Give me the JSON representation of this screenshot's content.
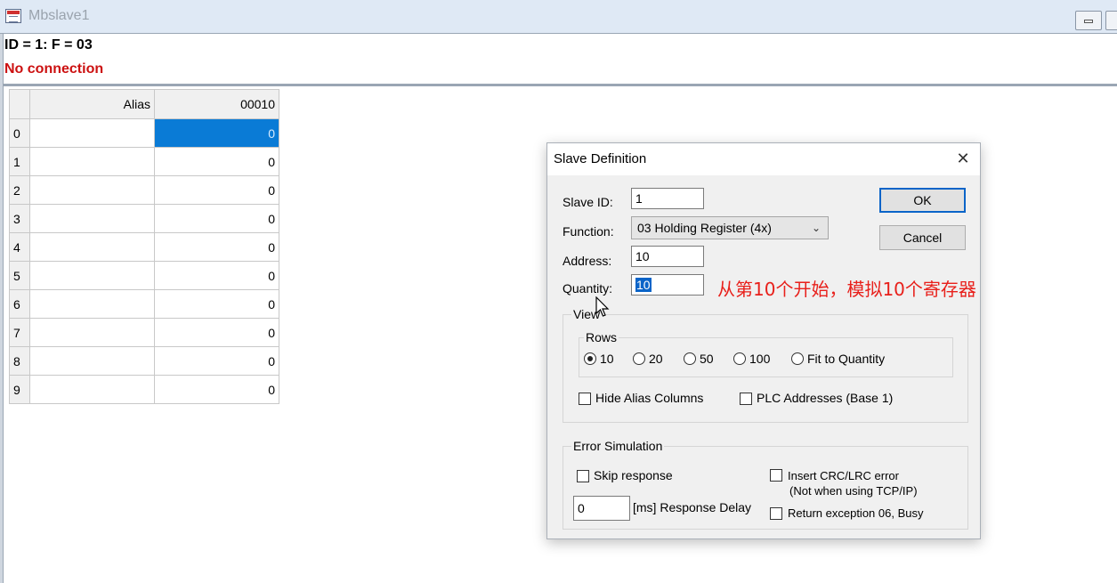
{
  "window": {
    "title": "Mbslave1"
  },
  "status": {
    "id_line": "ID = 1: F = 03",
    "connection": "No connection"
  },
  "grid": {
    "columns": [
      "Alias",
      "00010"
    ],
    "rows": [
      {
        "index": "0",
        "alias": "",
        "value": "0"
      },
      {
        "index": "1",
        "alias": "",
        "value": "0"
      },
      {
        "index": "2",
        "alias": "",
        "value": "0"
      },
      {
        "index": "3",
        "alias": "",
        "value": "0"
      },
      {
        "index": "4",
        "alias": "",
        "value": "0"
      },
      {
        "index": "5",
        "alias": "",
        "value": "0"
      },
      {
        "index": "6",
        "alias": "",
        "value": "0"
      },
      {
        "index": "7",
        "alias": "",
        "value": "0"
      },
      {
        "index": "8",
        "alias": "",
        "value": "0"
      },
      {
        "index": "9",
        "alias": "",
        "value": "0"
      }
    ],
    "selected_row": 0
  },
  "dialog": {
    "title": "Slave Definition",
    "close_glyph": "✕",
    "slave_id": {
      "label": "Slave ID:",
      "value": "1"
    },
    "function": {
      "label": "Function:",
      "value": "03 Holding Register (4x)"
    },
    "address": {
      "label": "Address:",
      "value": "10"
    },
    "quantity": {
      "label": "Quantity:",
      "value": "10"
    },
    "ok_label": "OK",
    "cancel_label": "Cancel",
    "view": {
      "label": "View",
      "rows_label": "Rows",
      "options": [
        {
          "label": "10",
          "checked": true
        },
        {
          "label": "20",
          "checked": false
        },
        {
          "label": "50",
          "checked": false
        },
        {
          "label": "100",
          "checked": false
        },
        {
          "label": "Fit to Quantity",
          "checked": false
        }
      ],
      "hide_alias_label": "Hide Alias Columns",
      "plc_addresses_label": "PLC Addresses (Base 1)"
    },
    "error_simulation": {
      "label": "Error Simulation",
      "skip_response_label": "Skip response",
      "insert_crc_label": "Insert CRC/LRC error",
      "insert_crc_note": "(Not when using TCP/IP)",
      "response_delay_value": "0",
      "response_delay_label": "[ms] Response Delay",
      "return_exception_label": "Return exception 06, Busy"
    }
  },
  "annotation": {
    "text": "从第10个开始，模拟10个寄存器",
    "color": "#e8201b"
  },
  "colors": {
    "selection": "#0a7bd6",
    "status_error": "#cc1111",
    "default_button_border": "#0a64c8"
  }
}
